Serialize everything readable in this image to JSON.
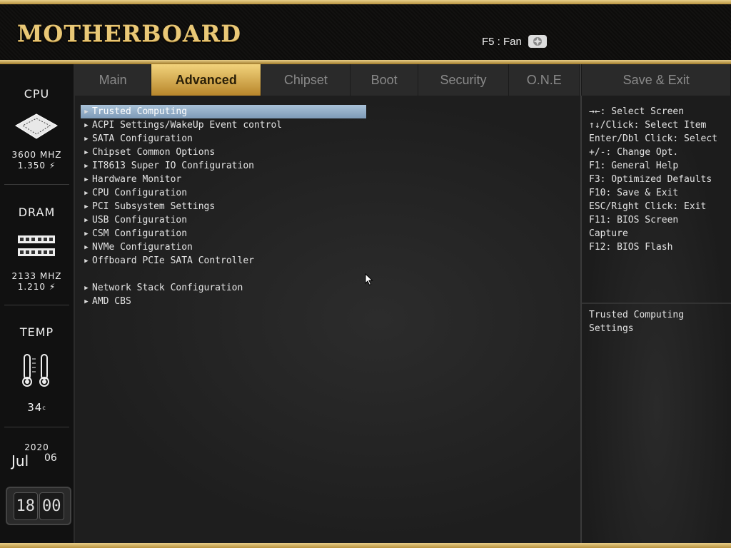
{
  "header": {
    "brand": "MOTHERBOARD",
    "fan_hint": "F5 : Fan"
  },
  "sidebar": {
    "cpu": {
      "title": "CPU",
      "freq": "3600 MHZ",
      "volt": "1.350"
    },
    "dram": {
      "title": "DRAM",
      "freq": "2133 MHZ",
      "volt": "1.210"
    },
    "temp": {
      "title": "TEMP",
      "value": "34"
    },
    "date": {
      "year": "2020",
      "month": "Jul",
      "day": "06"
    },
    "clock": {
      "hour": "18",
      "minute": "00"
    }
  },
  "tabs": [
    {
      "label": "Main"
    },
    {
      "label": "Advanced"
    },
    {
      "label": "Chipset"
    },
    {
      "label": "Boot"
    },
    {
      "label": "Security"
    },
    {
      "label": "O.N.E"
    },
    {
      "label": "Save & Exit"
    }
  ],
  "active_tab": "Advanced",
  "menu_items": [
    "Trusted Computing",
    "ACPI Settings/WakeUp Event control",
    "SATA Configuration",
    "Chipset Common Options",
    "IT8613 Super IO Configuration",
    "Hardware Monitor",
    "CPU Configuration",
    "PCI Subsystem Settings",
    "USB Configuration",
    "CSM Configuration",
    "NVMe Configuration",
    "Offboard PCIe SATA Controller",
    "Network Stack Configuration",
    "AMD CBS"
  ],
  "selected_item": "Trusted Computing",
  "help": {
    "keys": [
      "→←: Select Screen",
      "↑↓/Click: Select Item",
      "Enter/Dbl Click: Select",
      "+/-: Change Opt.",
      "F1: General Help",
      "F3: Optimized Defaults",
      "F10: Save & Exit",
      "ESC/Right Click: Exit",
      "F11: BIOS Screen",
      "Capture",
      "F12: BIOS Flash"
    ],
    "description": "Trusted Computing Settings"
  },
  "colors": {
    "gold": "#e9c877",
    "selection": "#8fadc8",
    "background": "#1e1e1e"
  }
}
